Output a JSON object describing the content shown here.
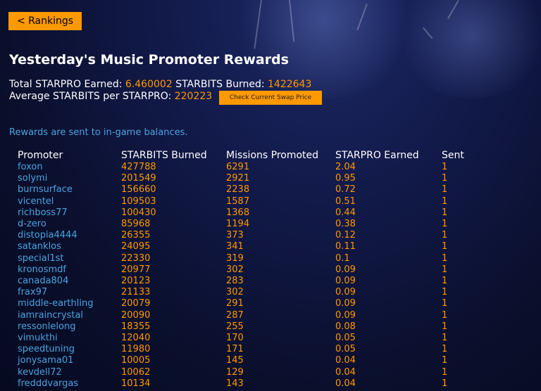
{
  "nav": {
    "back_label": "< Rankings"
  },
  "title": "Yesterday's Music Promoter Rewards",
  "summary": {
    "total_label": "Total STARPRO Earned:",
    "total_value": "6.460002",
    "burned_label": "STARBITS Burned:",
    "burned_value": "1422643",
    "avg_label": "Average STARBITS per STARPRO:",
    "avg_value": "220223",
    "swap_button": "Check Current Swap Price"
  },
  "note": "Rewards are sent to in-game balances.",
  "table": {
    "headers": [
      "Promoter",
      "STARBITS Burned",
      "Missions Promoted",
      "STARPRO Earned",
      "Sent"
    ],
    "rows": [
      [
        "foxon",
        "427788",
        "6291",
        "2.04",
        "1"
      ],
      [
        "solymi",
        "201549",
        "2921",
        "0.95",
        "1"
      ],
      [
        "burnsurface",
        "156660",
        "2238",
        "0.72",
        "1"
      ],
      [
        "vicentel",
        "109503",
        "1587",
        "0.51",
        "1"
      ],
      [
        "richboss77",
        "100430",
        "1368",
        "0.44",
        "1"
      ],
      [
        "d-zero",
        "85968",
        "1194",
        "0.38",
        "1"
      ],
      [
        "distopia4444",
        "26355",
        "373",
        "0.12",
        "1"
      ],
      [
        "satanklos",
        "24095",
        "341",
        "0.11",
        "1"
      ],
      [
        "special1st",
        "22330",
        "319",
        "0.1",
        "1"
      ],
      [
        "kronosmdf",
        "20977",
        "302",
        "0.09",
        "1"
      ],
      [
        "canada804",
        "20123",
        "283",
        "0.09",
        "1"
      ],
      [
        "frax97",
        "21133",
        "302",
        "0.09",
        "1"
      ],
      [
        "middle-earthling",
        "20079",
        "291",
        "0.09",
        "1"
      ],
      [
        "iamraincrystal",
        "20090",
        "287",
        "0.09",
        "1"
      ],
      [
        "ressonlelong",
        "18355",
        "255",
        "0.08",
        "1"
      ],
      [
        "vimukthi",
        "12040",
        "170",
        "0.05",
        "1"
      ],
      [
        "speedtuning",
        "11980",
        "171",
        "0.05",
        "1"
      ],
      [
        "jonysama01",
        "10005",
        "145",
        "0.04",
        "1"
      ],
      [
        "kevdell72",
        "10062",
        "129",
        "0.04",
        "1"
      ],
      [
        "fredddvargas",
        "10134",
        "143",
        "0.04",
        "1"
      ]
    ]
  }
}
